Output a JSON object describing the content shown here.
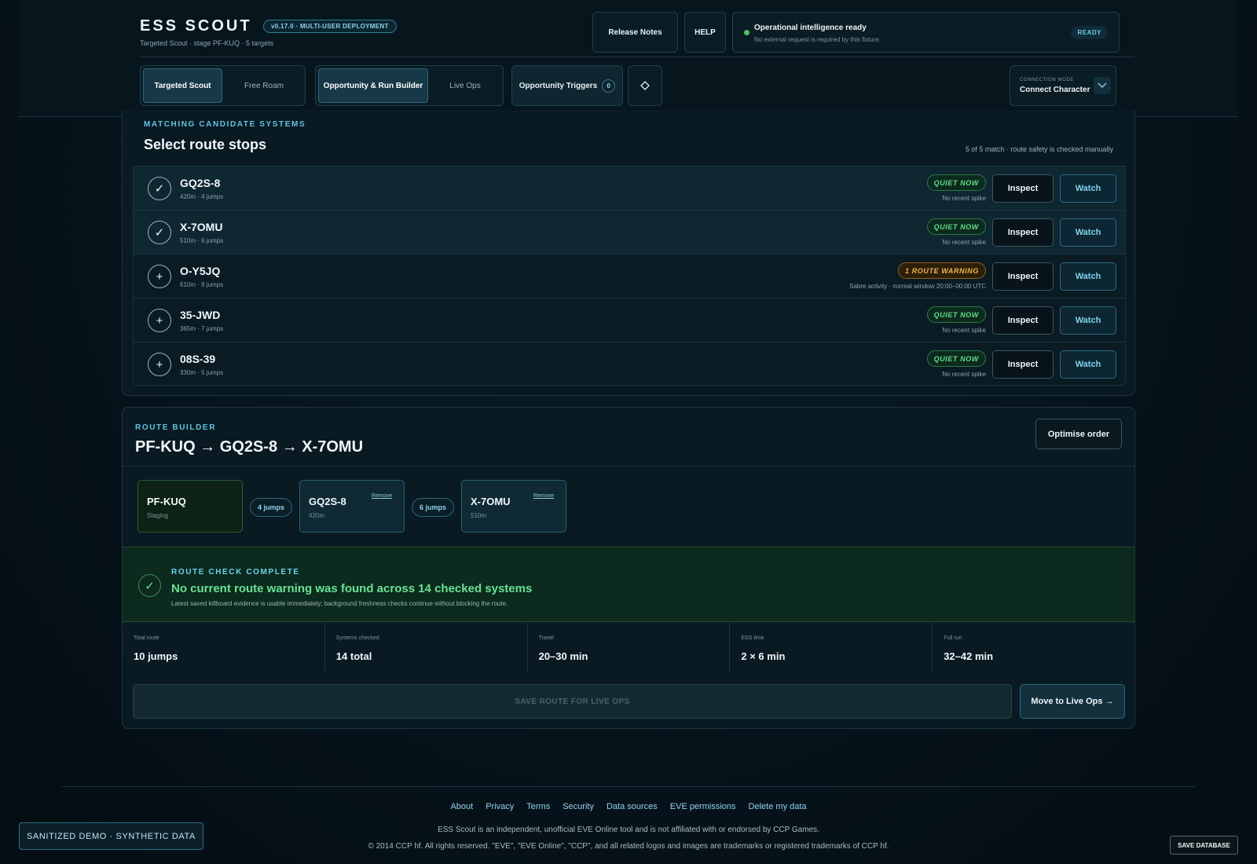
{
  "header": {
    "app_title": "ESS SCOUT",
    "version_badge": "v0.17.0 · MULTI-USER DEPLOYMENT",
    "subtitle": "Targeted Scout · stage PF-KUQ · 5 targets",
    "release_notes_label": "Release Notes",
    "help_label": "HELP",
    "status": {
      "title": "Operational intelligence ready",
      "subtitle": "No external request is required by this fixture.",
      "badge": "READY",
      "dot_color": "#4fc06a"
    },
    "mode_tabs": [
      {
        "label": "Targeted Scout",
        "active": true
      },
      {
        "label": "Free Roam",
        "active": false
      }
    ],
    "view_tabs": [
      {
        "label": "Opportunity & Run Builder",
        "active": true
      },
      {
        "label": "Live Ops",
        "active": false
      }
    ],
    "triggers": {
      "label": "Opportunity Triggers",
      "count": "0"
    },
    "diamond_icon": "diamond-icon",
    "connection": {
      "label": "CONNECTION MODE",
      "value": "Connect Character"
    }
  },
  "candidates": {
    "eyebrow": "MATCHING CANDIDATE SYSTEMS",
    "title": "Select route stops",
    "meta": "5 of 5 match · route safety is checked manually",
    "rows": [
      {
        "name": "GQ2S-8",
        "sub": "420m · 4 jumps",
        "selected": true,
        "check": "✓",
        "badge": "QUIET NOW",
        "badge_type": "quiet",
        "note": "No recent spike",
        "inspect": "Inspect",
        "watch": "Watch"
      },
      {
        "name": "X-7OMU",
        "sub": "510m · 6 jumps",
        "selected": true,
        "check": "✓",
        "badge": "QUIET NOW",
        "badge_type": "quiet",
        "note": "No recent spike",
        "inspect": "Inspect",
        "watch": "Watch"
      },
      {
        "name": "O-Y5JQ",
        "sub": "610m · 9 jumps",
        "selected": false,
        "check": "+",
        "badge": "1 ROUTE WARNING",
        "badge_type": "warn",
        "note": "Sabre activity · normal window 20:00–00:00 UTC",
        "inspect": "Inspect",
        "watch": "Watch"
      },
      {
        "name": "35-JWD",
        "sub": "365m · 7 jumps",
        "selected": false,
        "check": "+",
        "badge": "QUIET NOW",
        "badge_type": "quiet",
        "note": "No recent spike",
        "inspect": "Inspect",
        "watch": "Watch"
      },
      {
        "name": "08S-39",
        "sub": "330m · 5 jumps",
        "selected": false,
        "check": "+",
        "badge": "QUIET NOW",
        "badge_type": "quiet",
        "note": "No recent spike",
        "inspect": "Inspect",
        "watch": "Watch"
      }
    ]
  },
  "route_builder": {
    "eyebrow": "ROUTE BUILDER",
    "title": "PF-KUQ → GQ2S-8 → X-7OMU",
    "optimise_label": "Optimise order",
    "stops": [
      {
        "name": "PF-KUQ",
        "sub": "Staging",
        "remove": ""
      },
      {
        "name": "GQ2S-8",
        "sub": "420m",
        "remove": "Remove"
      },
      {
        "name": "X-7OMU",
        "sub": "510m",
        "remove": "Remove"
      }
    ],
    "legs": [
      "4 jumps",
      "6 jumps"
    ],
    "check": {
      "eyebrow": "ROUTE CHECK COMPLETE",
      "title": "No current route warning was found across 14 checked systems",
      "subtitle": "Latest saved killboard evidence is usable immediately; background freshness checks continue without blocking the route.",
      "icon": "✓"
    },
    "stats": [
      {
        "label": "Total route",
        "value": "10 jumps"
      },
      {
        "label": "Systems checked",
        "value": "14 total"
      },
      {
        "label": "Travel",
        "value": "20–30 min"
      },
      {
        "label": "ESS time",
        "value": "2 × 6 min"
      },
      {
        "label": "Full run",
        "value": "32–42 min"
      }
    ],
    "save_label": "SAVE ROUTE FOR LIVE OPS",
    "move_label": "Move to Live Ops →"
  },
  "footer": {
    "links": [
      "About",
      "Privacy",
      "Terms",
      "Security",
      "Data sources",
      "EVE permissions",
      "Delete my data"
    ],
    "disclaimer": "ESS Scout is an independent, unofficial EVE Online tool and is not affiliated with or endorsed by CCP Games.",
    "copyright": "© 2014 CCP hf. All rights reserved. \"EVE\", \"EVE Online\", \"CCP\", and all related logos and images are trademarks or registered trademarks of CCP hf.",
    "demo_badge": "SANITIZED DEMO · SYNTHETIC DATA",
    "save_db": "SAVE DATABASE"
  }
}
